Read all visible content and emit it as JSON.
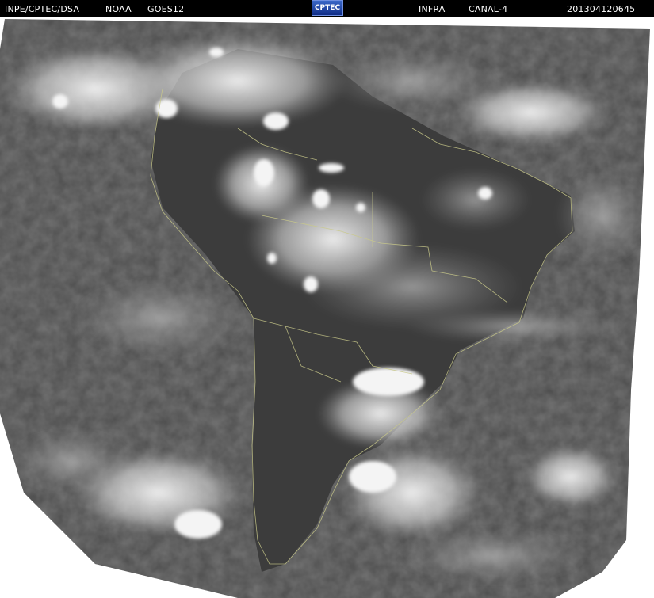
{
  "header": {
    "source": "INPE/CPTEC/DSA",
    "agency": "NOAA",
    "satellite": "GOES12",
    "logo_text": "CPTEC",
    "band": "INFRA",
    "channel": "CANAL-4",
    "timestamp": "201304120645"
  },
  "image": {
    "type": "infrared-satellite-image",
    "region": "South America",
    "colors": {
      "space": "#ffffff",
      "header": "#000000",
      "land": "#3a3a3a",
      "ocean": "#4b4b4b",
      "cloud": "#e6e6e6",
      "coastline": "#c9c98a"
    }
  }
}
